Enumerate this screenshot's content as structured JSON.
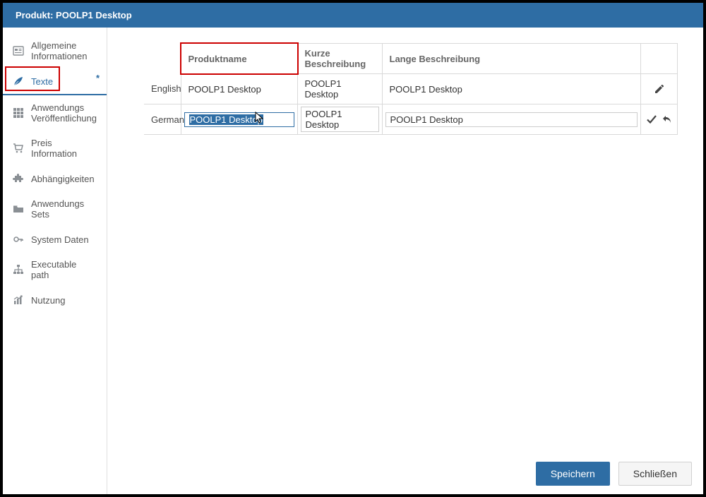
{
  "titlebar": "Produkt: POOLP1 Desktop",
  "sidebar": {
    "items": [
      {
        "label": "Allgemeine Informationen",
        "icon": "info-card-icon"
      },
      {
        "label": "Texte",
        "icon": "feather-icon",
        "active": true,
        "dirty": "*"
      },
      {
        "label": "Anwendungs Veröffentlichung",
        "icon": "grid-icon"
      },
      {
        "label": "Preis Information",
        "icon": "cart-icon"
      },
      {
        "label": "Abhängigkeiten",
        "icon": "puzzle-icon"
      },
      {
        "label": "Anwendungs Sets",
        "icon": "folder-icon"
      },
      {
        "label": "System Daten",
        "icon": "key-icon"
      },
      {
        "label": "Executable path",
        "icon": "sitemap-icon"
      },
      {
        "label": "Nutzung",
        "icon": "chart-icon"
      }
    ]
  },
  "table": {
    "headers": {
      "lang": "",
      "name": "Produktname",
      "short": "Kurze Beschreibung",
      "long": "Lange Beschreibung",
      "actions": ""
    },
    "rows": [
      {
        "lang": "English",
        "name": "POOLP1 Desktop",
        "short": "POOLP1 Desktop",
        "long": "POOLP1 Desktop",
        "mode": "view"
      },
      {
        "lang": "German",
        "name": "POOLP1 Desktop",
        "short": "POOLP1 Desktop",
        "long": "POOLP1 Desktop",
        "mode": "edit"
      }
    ]
  },
  "footer": {
    "save": "Speichern",
    "close": "Schließen"
  }
}
